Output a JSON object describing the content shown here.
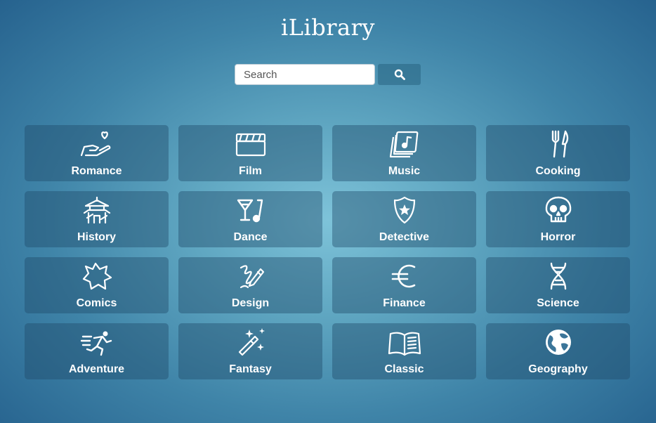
{
  "app": {
    "title": "iLibrary"
  },
  "search": {
    "placeholder": "Search",
    "value": "",
    "button_icon": "search-icon"
  },
  "categories": [
    {
      "label": "Romance",
      "icon": "heart-hand-icon"
    },
    {
      "label": "Film",
      "icon": "clapperboard-icon"
    },
    {
      "label": "Music",
      "icon": "music-album-icon"
    },
    {
      "label": "Cooking",
      "icon": "fork-knife-icon"
    },
    {
      "label": "History",
      "icon": "pagoda-icon"
    },
    {
      "label": "Dance",
      "icon": "cocktail-music-icon"
    },
    {
      "label": "Detective",
      "icon": "police-badge-icon"
    },
    {
      "label": "Horror",
      "icon": "skull-icon"
    },
    {
      "label": "Comics",
      "icon": "burst-icon"
    },
    {
      "label": "Design",
      "icon": "pencil-scribble-icon"
    },
    {
      "label": "Finance",
      "icon": "euro-icon"
    },
    {
      "label": "Science",
      "icon": "dna-icon"
    },
    {
      "label": "Adventure",
      "icon": "running-person-icon"
    },
    {
      "label": "Fantasy",
      "icon": "magic-wand-icon"
    },
    {
      "label": "Classic",
      "icon": "open-book-icon"
    },
    {
      "label": "Geography",
      "icon": "globe-icon"
    }
  ],
  "colors": {
    "background_center": "#7ec3d9",
    "background_edge": "#26628e",
    "tile": "rgba(30,75,105,0.42)",
    "text": "#ffffff"
  }
}
